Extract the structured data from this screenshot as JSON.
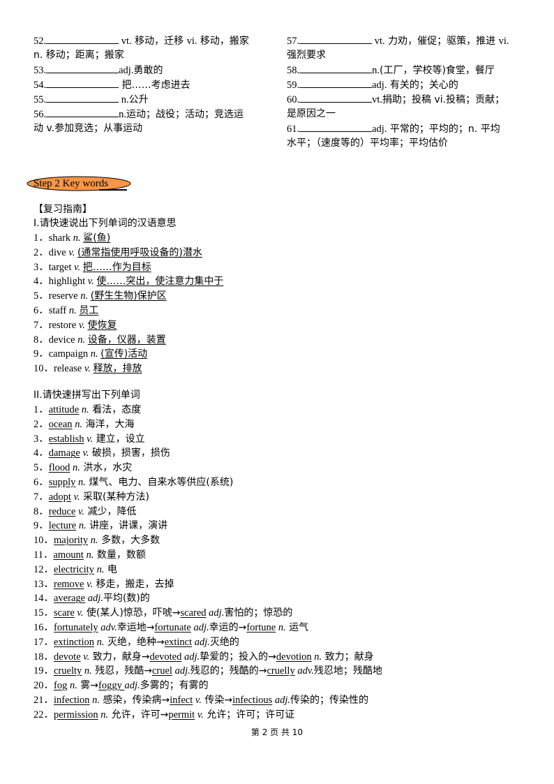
{
  "top_left": [
    {
      "num": "52.",
      "pos": "vt.",
      "text": " 移动，迁移 ",
      "pos2": "vi.",
      "text2": " 移动，搬家"
    },
    {
      "cont": "n. 移动；距离；搬家"
    },
    {
      "num": "53.",
      "pos": "adj.",
      "text": "勇敢的"
    },
    {
      "num": "54.",
      "text": " 把……考虑进去"
    },
    {
      "num": "55.",
      "pos": "n.",
      "text": "公升"
    },
    {
      "num": "56.",
      "pos": "n.",
      "text": "运动；战役；活动；竞选运"
    },
    {
      "cont": "动 v.参加竞选；从事运动"
    }
  ],
  "top_right": [
    {
      "num": "57.",
      "pos": "vt.",
      "text": " 力劝，催促；驱策，推进  ",
      "pos2": "vi."
    },
    {
      "cont": "强烈要求"
    },
    {
      "num": "58.",
      "pos": "n.",
      "text": "(工厂，学校等)食堂，餐厅"
    },
    {
      "num": "59.",
      "pos": "adj.",
      "text": " 有关的；关心的"
    },
    {
      "num": "60.",
      "pos": "vt.",
      "text": "捐助；投稿 vi.投稿；贡献；"
    },
    {
      "cont": "是原因之一"
    },
    {
      "num": "61.",
      "pos": "adj.",
      "text": " 平常的；平均的；n. 平均"
    },
    {
      "cont": "水平；（速度等的）平均率；平均估价"
    }
  ],
  "step_badge": {
    "label": "Step 2 Key words",
    "color": "#f79646"
  },
  "guide_title": "【复习指南】",
  "section1": {
    "title": "I.请快速说出下列单词的汉语意思",
    "items": [
      {
        "n": "1．",
        "word": "shark",
        "pos": "n.",
        "meaning": "鲨(鱼)"
      },
      {
        "n": "2．",
        "word": "dive",
        "pos": "v.",
        "meaning": "(通常指使用呼吸设备的)潜水"
      },
      {
        "n": "3．",
        "word": "target",
        "pos": "v.",
        "meaning": "把……作为目标"
      },
      {
        "n": "4．",
        "word": "highlight",
        "pos": "v.",
        "meaning": "使……突出，使注意力集中于"
      },
      {
        "n": "5．",
        "word": "reserve",
        "pos": "n.",
        "meaning": "(野生生物)保护区"
      },
      {
        "n": "6．",
        "word": "staff",
        "pos": "n.",
        "meaning": "员工"
      },
      {
        "n": "7．",
        "word": "restore",
        "pos": "v.",
        "meaning": "使恢复"
      },
      {
        "n": "8．",
        "word": "device",
        "pos": "n.",
        "meaning": "设备，仪器，装置"
      },
      {
        "n": "9．",
        "word": "campaign",
        "pos": "n.",
        "meaning": "(宣传)活动"
      },
      {
        "n": "10．",
        "word": "release",
        "pos": "v.",
        "meaning": "释放，排放"
      }
    ]
  },
  "section2": {
    "title": "II.请快速拼写出下列单词",
    "items": [
      {
        "n": "1．",
        "parts": [
          {
            "u": "attitude"
          },
          {
            "i": " n."
          },
          {
            "t": " 看法，态度"
          }
        ]
      },
      {
        "n": "2．",
        "parts": [
          {
            "u": "ocean"
          },
          {
            "i": " n."
          },
          {
            "t": " 海洋，大海"
          }
        ]
      },
      {
        "n": "3．",
        "parts": [
          {
            "u": "establish"
          },
          {
            "i": " v."
          },
          {
            "t": " 建立，设立"
          }
        ]
      },
      {
        "n": "4．",
        "parts": [
          {
            "u": "damage"
          },
          {
            "i": " v."
          },
          {
            "t": " 破损，损害，损伤"
          }
        ]
      },
      {
        "n": "5．",
        "parts": [
          {
            "u": "flood"
          },
          {
            "i": " n."
          },
          {
            "t": " 洪水，水灾"
          }
        ]
      },
      {
        "n": "6．",
        "parts": [
          {
            "u": "supply"
          },
          {
            "i": " n."
          },
          {
            "t": " 煤气、电力、自来水等供应(系统)"
          }
        ]
      },
      {
        "n": "7．",
        "parts": [
          {
            "u": "adopt"
          },
          {
            "i": " v."
          },
          {
            "t": " 采取(某种方法)"
          }
        ]
      },
      {
        "n": "8．",
        "parts": [
          {
            "u": "reduce"
          },
          {
            "i": " v."
          },
          {
            "t": " 减少，降低"
          }
        ]
      },
      {
        "n": "9．",
        "parts": [
          {
            "u": "lecture"
          },
          {
            "i": " n."
          },
          {
            "t": " 讲座，讲课，演讲"
          }
        ]
      },
      {
        "n": "10．",
        "parts": [
          {
            "u": "majority"
          },
          {
            "i": " n."
          },
          {
            "t": " 多数，大多数"
          }
        ]
      },
      {
        "n": "11．",
        "parts": [
          {
            "u": "amount"
          },
          {
            "i": " n."
          },
          {
            "t": " 数量，数额"
          }
        ]
      },
      {
        "n": "12．",
        "parts": [
          {
            "u": "electricity"
          },
          {
            "i": " n."
          },
          {
            "t": " 电"
          }
        ]
      },
      {
        "n": "13．",
        "parts": [
          {
            "u": "remove"
          },
          {
            "i": " v."
          },
          {
            "t": " 移走，搬走，去掉"
          }
        ]
      },
      {
        "n": "14．",
        "parts": [
          {
            "u": "average"
          },
          {
            "i": " adj."
          },
          {
            "t": "平均(数)的"
          }
        ]
      },
      {
        "n": "15．",
        "parts": [
          {
            "u": "scare"
          },
          {
            "i": " v."
          },
          {
            "t": " 使(某人)惊恐，吓唬→"
          },
          {
            "u": "scared"
          },
          {
            "i": " adj."
          },
          {
            "t": "害怕的；惊恐的"
          }
        ]
      },
      {
        "n": "16．",
        "parts": [
          {
            "u": "fortunately"
          },
          {
            "i": " adv."
          },
          {
            "t": "幸运地→"
          },
          {
            "u": "fortunate"
          },
          {
            "i": " adj."
          },
          {
            "t": "幸运的→"
          },
          {
            "u": "fortune"
          },
          {
            "i": " n."
          },
          {
            "t": " 运气"
          }
        ]
      },
      {
        "n": "17．",
        "parts": [
          {
            "u": "extinction"
          },
          {
            "i": " n."
          },
          {
            "t": " 灭绝，绝种→"
          },
          {
            "u": "extinct"
          },
          {
            "i": " adj."
          },
          {
            "t": "灭绝的"
          }
        ]
      },
      {
        "n": "18．",
        "parts": [
          {
            "u": "devote"
          },
          {
            "i": " v."
          },
          {
            "t": " 致力，献身→"
          },
          {
            "u": "devoted"
          },
          {
            "i": " adj."
          },
          {
            "t": "挚爱的；投入的→"
          },
          {
            "u": "devotion"
          },
          {
            "i": " n."
          },
          {
            "t": " 致力；献身"
          }
        ]
      },
      {
        "n": "19．",
        "parts": [
          {
            "u": "cruelty"
          },
          {
            "i": " n."
          },
          {
            "t": " 残忍，残酷→"
          },
          {
            "u": "cruel"
          },
          {
            "i": " adj."
          },
          {
            "t": "残忍的；残酷的→"
          },
          {
            "u": "cruelly"
          },
          {
            "i": " adv."
          },
          {
            "t": "残忍地；残酷地"
          }
        ]
      },
      {
        "n": "20．",
        "parts": [
          {
            "u": "fog"
          },
          {
            "i": " n."
          },
          {
            "t": " 雾→"
          },
          {
            "u": "foggy  "
          },
          {
            "i": " adj."
          },
          {
            "t": "多雾的；有雾的"
          }
        ]
      },
      {
        "n": "21．",
        "parts": [
          {
            "u": "infection"
          },
          {
            "i": " n."
          },
          {
            "t": " 感染，传染病→"
          },
          {
            "u": "infect"
          },
          {
            "i": " v."
          },
          {
            "t": " 传染→"
          },
          {
            "u": "infectious"
          },
          {
            "i": " adj."
          },
          {
            "t": "传染的；传染性的"
          }
        ]
      },
      {
        "n": "22．",
        "parts": [
          {
            "u": "permission"
          },
          {
            "i": " n."
          },
          {
            "t": " 允许，许可→"
          },
          {
            "u": "permit"
          },
          {
            "i": " v."
          },
          {
            "t": " 允许；许可；许可证"
          }
        ]
      }
    ]
  },
  "footer": "第 2 页 共 10"
}
